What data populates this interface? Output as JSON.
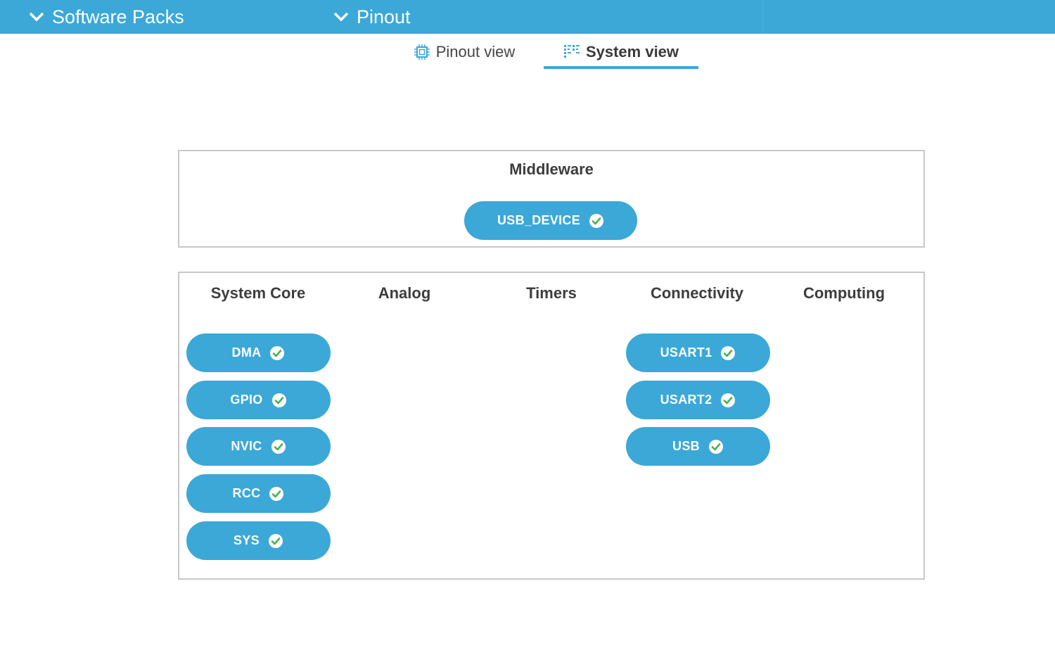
{
  "topbar": {
    "software_packs_label": "Software Packs",
    "pinout_label": "Pinout",
    "accent_color": "#3ba8d8"
  },
  "tabs": [
    {
      "label": "Pinout view",
      "icon": "chip-icon",
      "active": false
    },
    {
      "label": "System view",
      "icon": "system-view-icon",
      "active": true
    }
  ],
  "middleware": {
    "title": "Middleware",
    "items": [
      {
        "label": "USB_DEVICE",
        "status": "ok"
      }
    ]
  },
  "categories": {
    "columns": [
      {
        "title": "System Core",
        "items": [
          {
            "label": "DMA",
            "status": "ok"
          },
          {
            "label": "GPIO",
            "status": "ok"
          },
          {
            "label": "NVIC",
            "status": "ok"
          },
          {
            "label": "RCC",
            "status": "ok"
          },
          {
            "label": "SYS",
            "status": "ok"
          }
        ]
      },
      {
        "title": "Analog",
        "items": []
      },
      {
        "title": "Timers",
        "items": []
      },
      {
        "title": "Connectivity",
        "items": [
          {
            "label": "USART1",
            "status": "ok"
          },
          {
            "label": "USART2",
            "status": "ok"
          },
          {
            "label": "USB",
            "status": "ok"
          }
        ]
      },
      {
        "title": "Computing",
        "items": []
      }
    ]
  }
}
